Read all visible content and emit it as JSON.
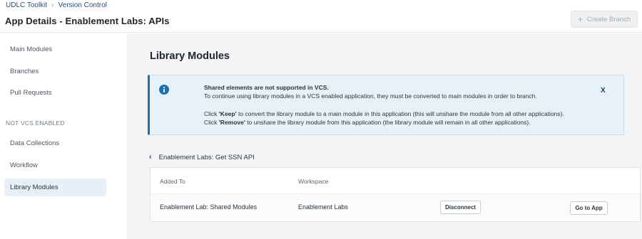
{
  "breadcrumb": {
    "items": [
      "UDLC Toolkit",
      "Version Control"
    ]
  },
  "header": {
    "title": "App Details -  Enablement Labs: APIs",
    "create_branch_label": "Create Branch"
  },
  "sidebar": {
    "items": [
      {
        "label": "Main Modules"
      },
      {
        "label": "Branches"
      },
      {
        "label": "Pull Requests"
      }
    ],
    "section_label": "NOT VCS ENABLED",
    "section_items": [
      {
        "label": "Data Collections"
      },
      {
        "label": "Workflow"
      },
      {
        "label": "Library Modules",
        "active": true
      }
    ]
  },
  "main": {
    "title": "Library Modules",
    "alert": {
      "heading": "Shared elements are not supported in VCS.",
      "line1": "To continue using library modules in a VCS enabled application, they must be converted to main modules in order to branch.",
      "keep_prefix": "Click ",
      "keep_word": "'Keep'",
      "keep_rest": " to convert the library module to a main module in this application (this will unshare the module from all other applications).",
      "remove_prefix": "Click ",
      "remove_word": "'Remove'",
      "remove_rest": " to unshare the library module from this application (the library module will remain in all other applications).",
      "close_label": "X"
    },
    "module_name": "Enablement Labs: Get SSN API",
    "table": {
      "columns": [
        "Added To",
        "Workspace"
      ],
      "rows": [
        {
          "added_to": "Enablement Lab: Shared Modules",
          "workspace": "Enablement Labs",
          "disconnect_label": "Disconnect",
          "go_to_app_label": "Go to App"
        }
      ]
    }
  }
}
